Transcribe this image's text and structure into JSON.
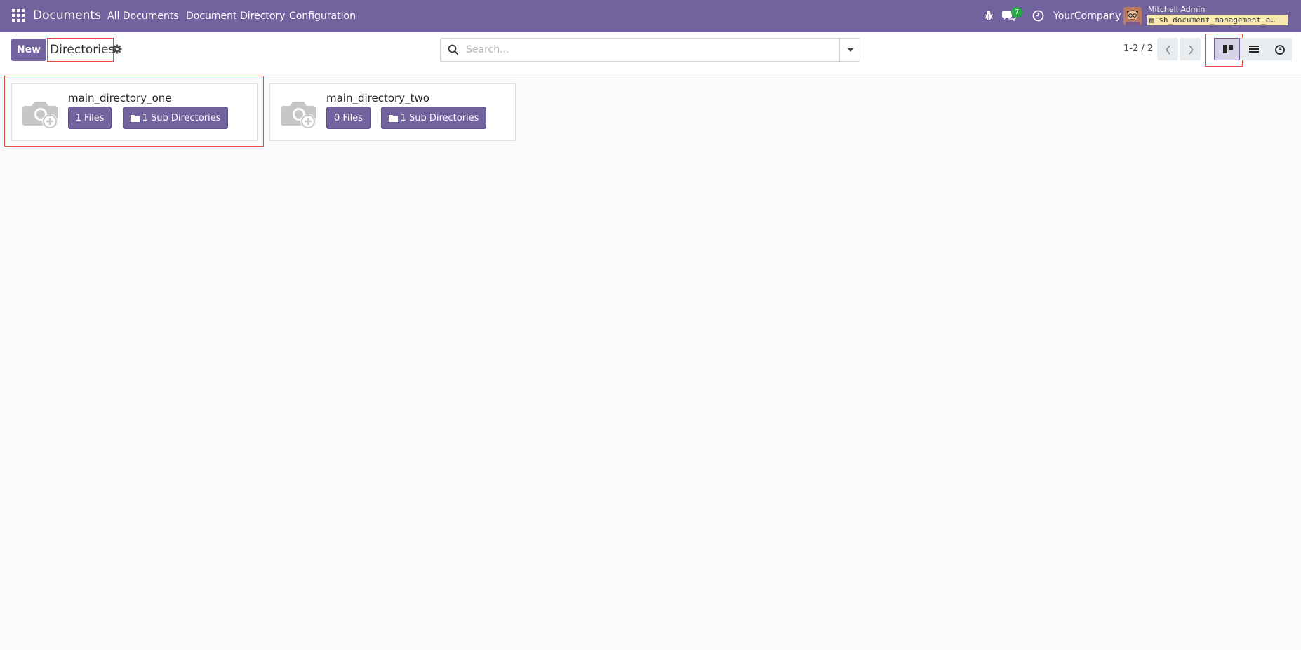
{
  "navbar": {
    "app_name": "Documents",
    "menu": [
      "All Documents",
      "Document Directory",
      "Configuration"
    ],
    "message_count": "7",
    "company": "YourCompany",
    "user_name": "Mitchell Admin",
    "database": "sh_document_management_a…",
    "colors": {
      "navbar_bg": "#71639e",
      "badge": "#28a745"
    }
  },
  "control_panel": {
    "new_label": "New",
    "title": "Directories",
    "search_placeholder": "Search...",
    "pager": "1-2 / 2",
    "views": [
      "kanban-icon",
      "list-icon",
      "activity-icon"
    ],
    "active_view": "kanban"
  },
  "cards": [
    {
      "name": "main_directory_one",
      "files_label": "1 Files",
      "subdir_label": "1 Sub Directories"
    },
    {
      "name": "main_directory_two",
      "files_label": "0 Files",
      "subdir_label": "1 Sub Directories"
    }
  ],
  "icons": {
    "card_image": "camera-add-icon",
    "subdir": "folder-icon"
  }
}
